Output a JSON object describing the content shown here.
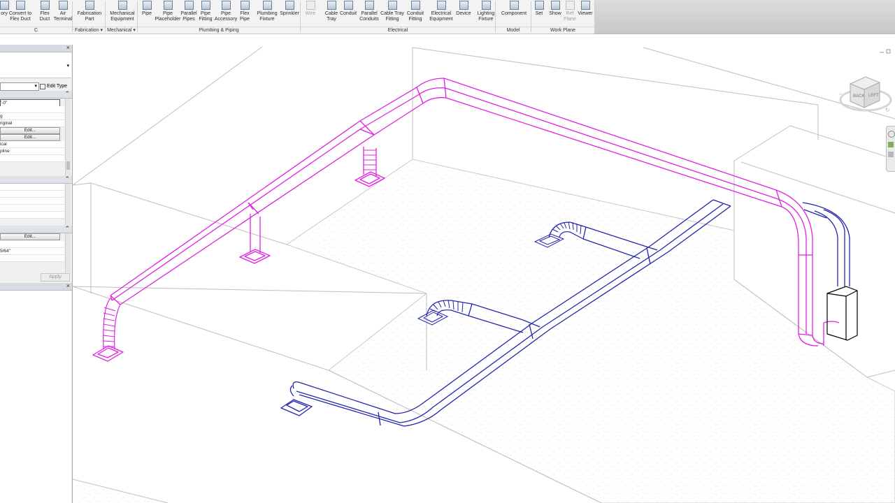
{
  "ribbon": {
    "tools": [
      {
        "name": "ory",
        "label": "ory",
        "dim": false
      },
      {
        "name": "convert-to-flex-duct",
        "label": "Convert to\nFlex Duct",
        "dim": false
      },
      {
        "name": "flex-duct",
        "label": "Flex\nDuct",
        "dim": false
      },
      {
        "name": "air-terminal",
        "label": "Air\nTerminal",
        "dim": false
      },
      {
        "name": "fabrication-part",
        "label": "Fabrication\nPart",
        "dim": false
      },
      {
        "name": "mechanical-equipment",
        "label": "Mechanical\nEquipment",
        "dim": false
      },
      {
        "name": "pipe",
        "label": "Pipe",
        "dim": false
      },
      {
        "name": "pipe-placeholder",
        "label": "Pipe\nPlaceholder",
        "dim": false
      },
      {
        "name": "parallel-pipes",
        "label": "Parallel\nPipes",
        "dim": false
      },
      {
        "name": "pipe-fitting",
        "label": "Pipe\nFitting",
        "dim": false
      },
      {
        "name": "pipe-accessory",
        "label": "Pipe\nAccessory",
        "dim": false
      },
      {
        "name": "flex-pipe",
        "label": "Flex\nPipe",
        "dim": false
      },
      {
        "name": "plumbing-fixture",
        "label": "Plumbing\nFixture",
        "dim": false
      },
      {
        "name": "sprinkler",
        "label": "Sprinkler",
        "dim": false
      },
      {
        "name": "wire",
        "label": "Wire",
        "dim": true
      },
      {
        "name": "cable-tray",
        "label": "Cable\nTray",
        "dim": false
      },
      {
        "name": "conduit",
        "label": "Conduit",
        "dim": false
      },
      {
        "name": "parallel-conduits",
        "label": "Parallel\nConduits",
        "dim": false
      },
      {
        "name": "cable-tray-fitting",
        "label": "Cable Tray\nFitting",
        "dim": false
      },
      {
        "name": "conduit-fitting",
        "label": "Conduit\nFitting",
        "dim": false
      },
      {
        "name": "electrical-equipment",
        "label": "Electrical\nEquipment",
        "dim": false
      },
      {
        "name": "device",
        "label": "Device",
        "dim": false
      },
      {
        "name": "lighting-fixture",
        "label": "Lighting\nFixture",
        "dim": false
      },
      {
        "name": "component",
        "label": "Component",
        "dim": false
      },
      {
        "name": "set-work-plane",
        "label": "Set",
        "dim": false
      },
      {
        "name": "show-work-plane",
        "label": "Show",
        "dim": false
      },
      {
        "name": "ref-plane",
        "label": "Ref\nPlane",
        "dim": true
      },
      {
        "name": "viewer",
        "label": "Viewer",
        "dim": false
      }
    ],
    "panels": [
      {
        "name": "hvac",
        "label": "C"
      },
      {
        "name": "fabrication",
        "label": "Fabrication ▾"
      },
      {
        "name": "mechanical",
        "label": "Mechanical ▾"
      },
      {
        "name": "plumbing-piping",
        "label": "Plumbing & Piping"
      },
      {
        "name": "electrical",
        "label": "Electrical"
      },
      {
        "name": "model",
        "label": "Model"
      },
      {
        "name": "work-plane",
        "label": "Work Plane"
      }
    ]
  },
  "properties": {
    "edit_type": "Edit Type",
    "rows": [
      {
        "text": "'-0\"",
        "type": "field"
      },
      {
        "text": "",
        "type": "row"
      },
      {
        "text": "g",
        "type": "row"
      },
      {
        "text": "riginal",
        "type": "row"
      },
      {
        "text": "Edit...",
        "type": "btn"
      },
      {
        "text": "Edit...",
        "type": "btn"
      },
      {
        "text": "ical",
        "type": "row"
      },
      {
        "text": "pline",
        "type": "row"
      },
      {
        "text": "",
        "type": "row"
      }
    ],
    "edit_button": "Edit...",
    "value_fraction": "5/64\"",
    "apply": "Apply"
  },
  "viewcube": {
    "face": "BACK",
    "side": "LEFT"
  },
  "colors": {
    "supply": "#e020e0",
    "return": "#2226a8",
    "ribbon_bg": "#f3f3f3",
    "floor_dots": "#c8c8c8"
  }
}
